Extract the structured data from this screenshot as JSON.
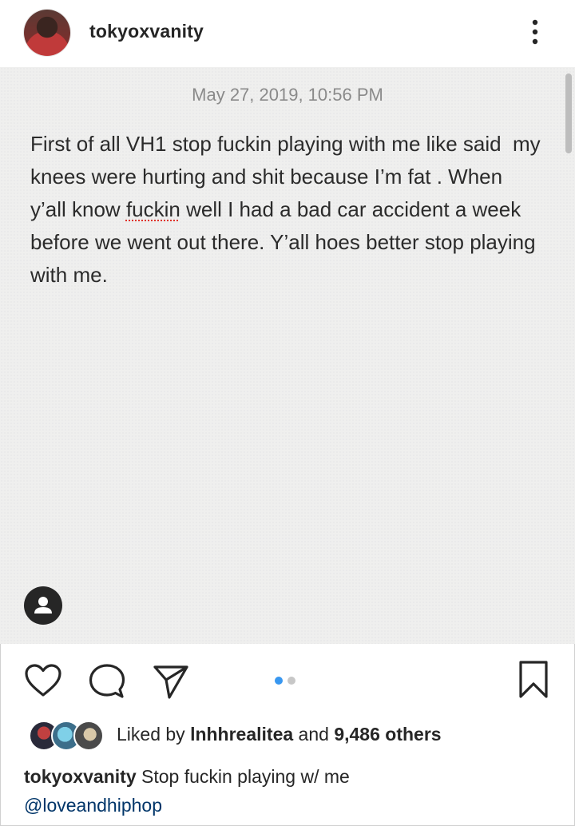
{
  "post": {
    "username": "tokyoxvanity",
    "note": {
      "date": "May 27, 2019, 10:56 PM",
      "body_before": "First of all VH1 stop fuckin playing with me like said  my knees were hurting and shit because I’m fat . When y’all know ",
      "body_flagged_word": "fuckin",
      "body_after": " well I had a bad car accident a week before we went out there. Y’all hoes better stop playing with me."
    },
    "likes": {
      "prefix": "Liked by ",
      "user": "lnhhrealitea",
      "middle": " and ",
      "count": "9,486 others"
    },
    "caption": {
      "username": "tokyoxvanity",
      "text": " Stop fuckin playing w/ me",
      "mention": "@loveandhiphop"
    },
    "carousel": {
      "total": 2,
      "active": 1
    }
  },
  "colors": {
    "accent_blue": "#3897f0",
    "inactive_dot": "#c7c7c7",
    "note_bg": "#efefee",
    "mention": "#003569"
  },
  "icons": [
    "more-options-icon",
    "user-tag-icon",
    "heart-icon",
    "comment-icon",
    "share-icon",
    "bookmark-icon"
  ]
}
